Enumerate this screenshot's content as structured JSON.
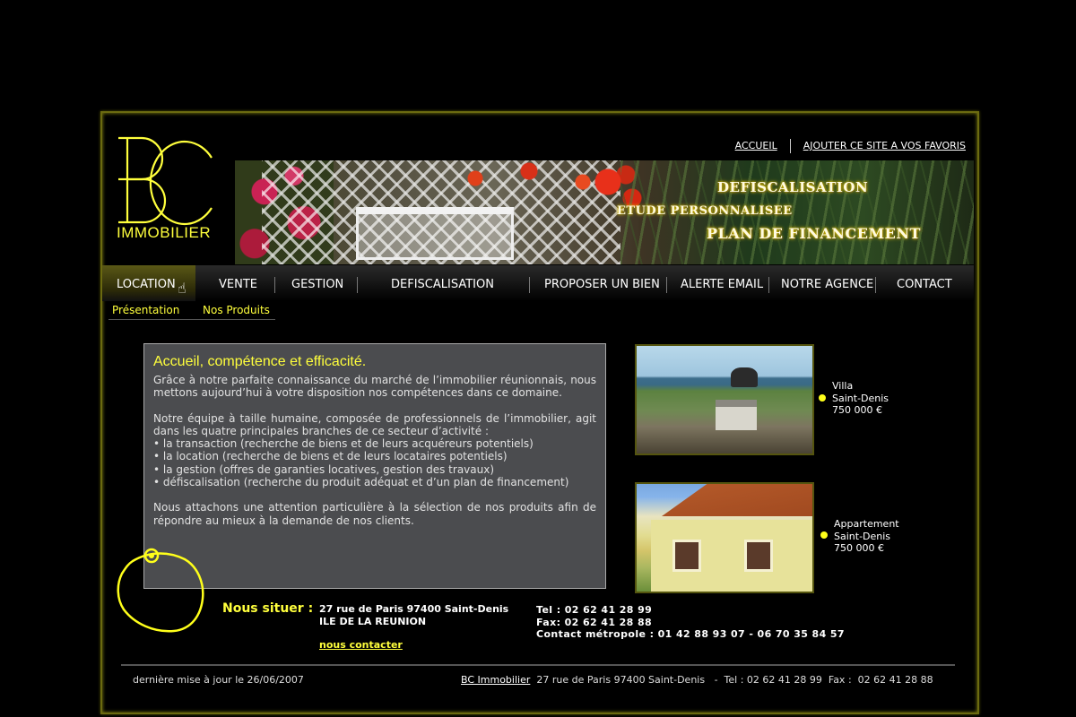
{
  "logo": {
    "letters": "BC",
    "subtitle": "IMMOBILIER"
  },
  "top_links": {
    "home": "ACCUEIL",
    "favorites": "AJOUTER CE SITE A VOS  FAVORIS"
  },
  "banner": {
    "line1": "DEFISCALISATION",
    "line2": "ETUDE PERSONNALISEE",
    "line3": "PLAN DE FINANCEMENT"
  },
  "nav": {
    "items": [
      "LOCATION",
      "VENTE",
      "GESTION",
      "DEFISCALISATION",
      "PROPOSER UN BIEN",
      "ALERTE EMAIL",
      "NOTRE AGENCE",
      "CONTACT"
    ],
    "active": "LOCATION"
  },
  "subnav": {
    "items": [
      "Présentation",
      "Nos Produits"
    ]
  },
  "content": {
    "title": "Accueil, compétence et efficacité.",
    "p1": "Grâce à notre parfaite connaissance du marché de l’immobilier réunionnais, nous mettons aujourd’hui à votre disposition nos compétences dans ce domaine.",
    "p2_intro": "Notre équipe à taille humaine, composée de professionnels de l’immobilier, agit dans les quatre principales branches de ce secteur d’activité :",
    "bullets": [
      "• la transaction (recherche de biens et de leurs acquéreurs potentiels)",
      "• la location (recherche de biens et de leurs locataires potentiels)",
      "• la gestion (offres de garanties locatives, gestion des travaux)",
      "• défiscalisation (recherche du produit adéquat et d’un plan de financement)"
    ],
    "p3": "Nous attachons une attention particulière à la sélection de nos produits afin de répondre au mieux à la demande de nos clients."
  },
  "location": {
    "label": "Nous situer :",
    "address_line1": "27 rue de Paris 97400 Saint-Denis",
    "address_line2": "ILE DE LA REUNION",
    "contact_link": "nous contacter",
    "tel": "Tel : 02 62 41 28 99",
    "fax": "Fax: 02 62 41 28 88",
    "metropole": "Contact métropole : 01 42 88 93 07 - 06 70 35 84 57"
  },
  "products": [
    {
      "type": "Villa",
      "city": "Saint-Denis",
      "price": "750 000 €"
    },
    {
      "type": "Appartement",
      "city": "Saint-Denis",
      "price": "750 000 €"
    }
  ],
  "footer": {
    "updated": "dernière mise à jour le 26/06/2007",
    "company": "BC Immobilier",
    "details": "  27 rue de Paris 97400 Saint-Denis   -  Tel : 02 62 41 28 99  Fax :  02 62 41 28 88"
  },
  "colors": {
    "accent": "#ffff3c",
    "content_bg": "#4b4c4f",
    "frame_border": "#6b6a10"
  }
}
